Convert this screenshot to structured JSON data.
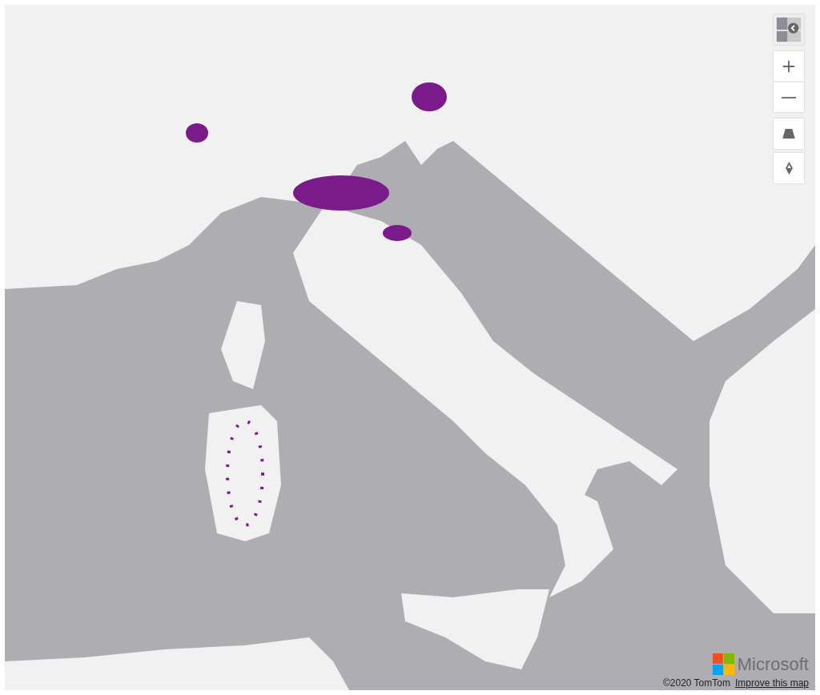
{
  "controls": [
    {
      "kind": "style"
    },
    {
      "kind": "zoom_in"
    },
    {
      "kind": "zoom_out"
    },
    {
      "kind": "pitch"
    },
    {
      "kind": "compass"
    }
  ],
  "logo": {
    "text": "Microsoft"
  },
  "attribution": {
    "copyright": "©2020 TomTom",
    "link": "Improve this map"
  }
}
